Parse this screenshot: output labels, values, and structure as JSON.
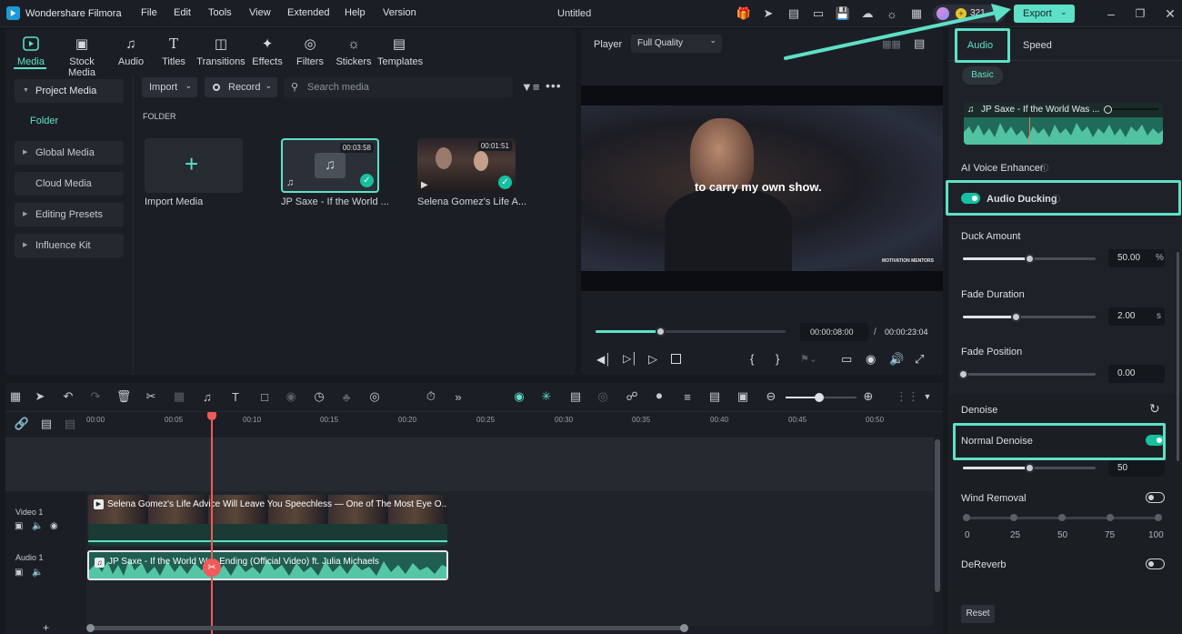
{
  "app": {
    "name": "Wondershare Filmora",
    "project_title": "Untitled",
    "credits": "321",
    "export_label": "Export"
  },
  "menu": [
    "File",
    "Edit",
    "Tools",
    "View",
    "Extended",
    "Help",
    "Version"
  ],
  "nav_tabs": [
    {
      "label": "Media",
      "icon": "media-icon"
    },
    {
      "label": "Stock Media",
      "icon": "stock-media-icon"
    },
    {
      "label": "Audio",
      "icon": "audio-icon"
    },
    {
      "label": "Titles",
      "icon": "titles-icon"
    },
    {
      "label": "Transitions",
      "icon": "transitions-icon"
    },
    {
      "label": "Effects",
      "icon": "effects-icon"
    },
    {
      "label": "Filters",
      "icon": "filters-icon"
    },
    {
      "label": "Stickers",
      "icon": "stickers-icon"
    },
    {
      "label": "Templates",
      "icon": "templates-icon"
    }
  ],
  "sidebar": {
    "project_media": "Project Media",
    "folder": "Folder",
    "global_media": "Global Media",
    "cloud_media": "Cloud Media",
    "editing_presets": "Editing Presets",
    "influence_kit": "Influence Kit"
  },
  "media_toolbar": {
    "import_label": "Import",
    "record_label": "Record",
    "search_placeholder": "Search media"
  },
  "media": {
    "folder_heading": "FOLDER",
    "import_media_label": "Import Media",
    "items": [
      {
        "name": "JP Saxe - If the World ...",
        "duration": "00:03:58"
      },
      {
        "name": "Selena Gomez's Life A...",
        "duration": "00:01:51"
      }
    ]
  },
  "player": {
    "player_label": "Player",
    "quality": "Full Quality",
    "caption": "to carry my own show.",
    "watermark": "MOTIVATION MENTORS",
    "current_time": "00:00:08:00",
    "separator": "/",
    "total_time": "00:00:23:04",
    "progress": 0.34
  },
  "right_panel": {
    "tab_audio": "Audio",
    "tab_speed": "Speed",
    "basic_label": "Basic",
    "clip_name": "JP Saxe - If the World Was ...",
    "ai_voice_enhancer": "AI Voice Enhancer",
    "audio_ducking": "Audio Ducking",
    "duck_amount_label": "Duck Amount",
    "duck_amount_value": "50.00",
    "duck_amount_unit": "%",
    "duck_amount_level": 0.5,
    "fade_duration_label": "Fade Duration",
    "fade_duration_value": "2.00",
    "fade_duration_unit": "s",
    "fade_duration_level": 0.4,
    "fade_position_label": "Fade Position",
    "fade_position_value": "0.00",
    "fade_position_level": 0.0,
    "denoise_label": "Denoise",
    "normal_denoise_label": "Normal Denoise",
    "normal_denoise_value": "50",
    "normal_denoise_level": 0.5,
    "wind_removal_label": "Wind Removal",
    "wind_ticks": [
      "0",
      "25",
      "50",
      "75",
      "100"
    ],
    "dereverb_label": "DeReverb",
    "reset_label": "Reset"
  },
  "timeline": {
    "ruler": [
      "00:00",
      "00:05",
      "00:10",
      "00:15",
      "00:20",
      "00:25",
      "00:30",
      "00:35",
      "00:40",
      "00:45",
      "00:50"
    ],
    "video_track_label": "Video 1",
    "audio_track_label": "Audio 1",
    "video_clip_title": "Selena Gomez's Life Advice Will Leave You Speechless — One of The Most Eye O...",
    "audio_clip_title": "JP Saxe - If the World Was Ending (Official Video) ft. Julia Michaels"
  },
  "colors": {
    "accent": "#17c0a0",
    "highlight": "#5ee0c8",
    "playhead": "#f05a5a"
  }
}
